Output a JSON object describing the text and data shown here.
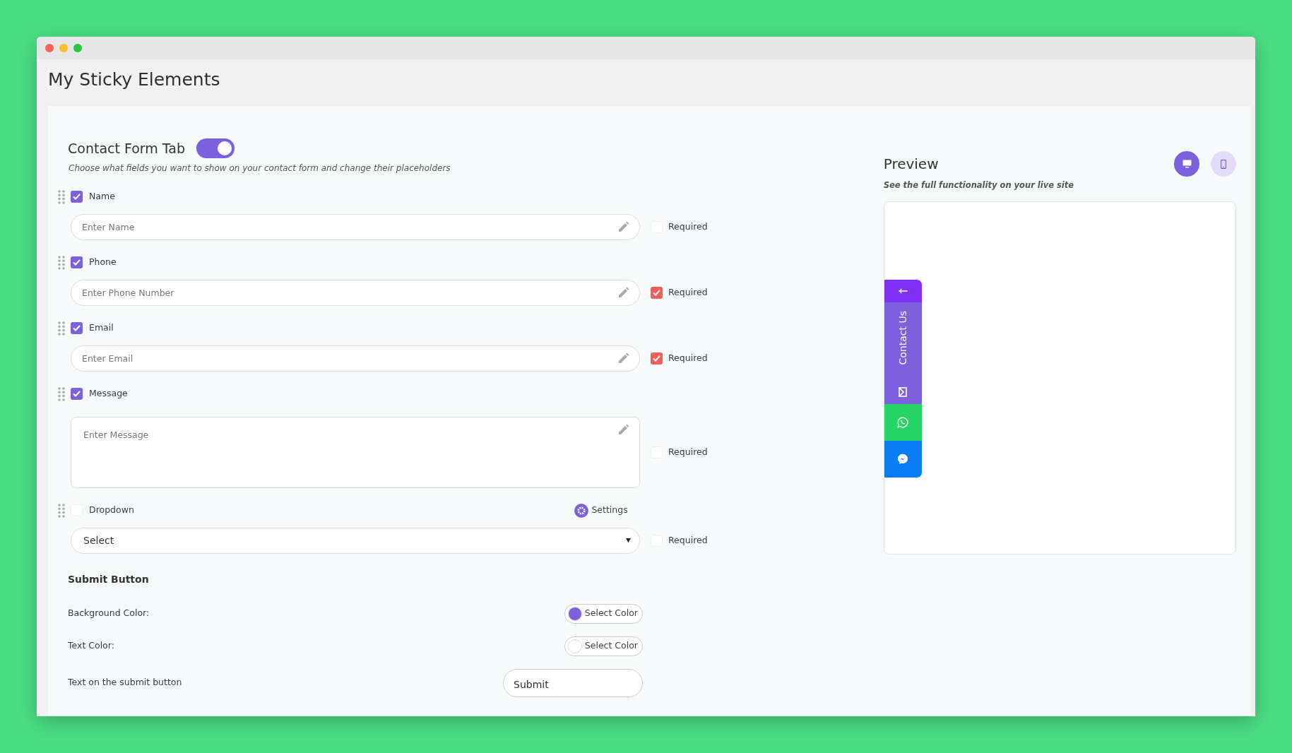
{
  "window": {
    "title": "My Sticky Elements"
  },
  "contact_form": {
    "title": "Contact Form Tab",
    "enabled": true,
    "description": "Choose what fields you want to show on your contact form and change their placeholders",
    "fields": [
      {
        "kind": "input",
        "label": "Name",
        "checked": true,
        "placeholder": "Enter Name",
        "required_label": "Required",
        "required": false
      },
      {
        "kind": "input",
        "label": "Phone",
        "checked": true,
        "placeholder": "Enter Phone Number",
        "required_label": "Required",
        "required": true
      },
      {
        "kind": "input",
        "label": "Email",
        "checked": true,
        "placeholder": "Enter Email",
        "required_label": "Required",
        "required": true
      },
      {
        "kind": "textarea",
        "label": "Message",
        "checked": true,
        "placeholder": "Enter Message",
        "required_label": "Required",
        "required": false
      },
      {
        "kind": "select",
        "label": "Dropdown",
        "checked": false,
        "settings_label": "Settings",
        "value": "Select",
        "required_label": "Required",
        "required": false
      }
    ]
  },
  "submit_button": {
    "heading": "Submit Button",
    "settings": [
      {
        "kind": "color",
        "label": "Background Color:",
        "button": "Select Color",
        "color": "#7b61dd"
      },
      {
        "kind": "color",
        "label": "Text Color:",
        "button": "Select Color",
        "color": "#ffffff"
      },
      {
        "kind": "text",
        "label": "Text on the submit button",
        "value": "Submit"
      }
    ]
  },
  "preview": {
    "title": "Preview",
    "subtitle": "See the full functionality on your live site",
    "devices": [
      {
        "kind": "desktop",
        "selected": true
      },
      {
        "kind": "mobile",
        "selected": false
      }
    ],
    "tab": {
      "label": "Contact Us"
    },
    "channels": [
      {
        "kind": "whatsapp",
        "color": "#25d366"
      },
      {
        "kind": "messenger",
        "color": "#0a7cf5"
      }
    ]
  }
}
